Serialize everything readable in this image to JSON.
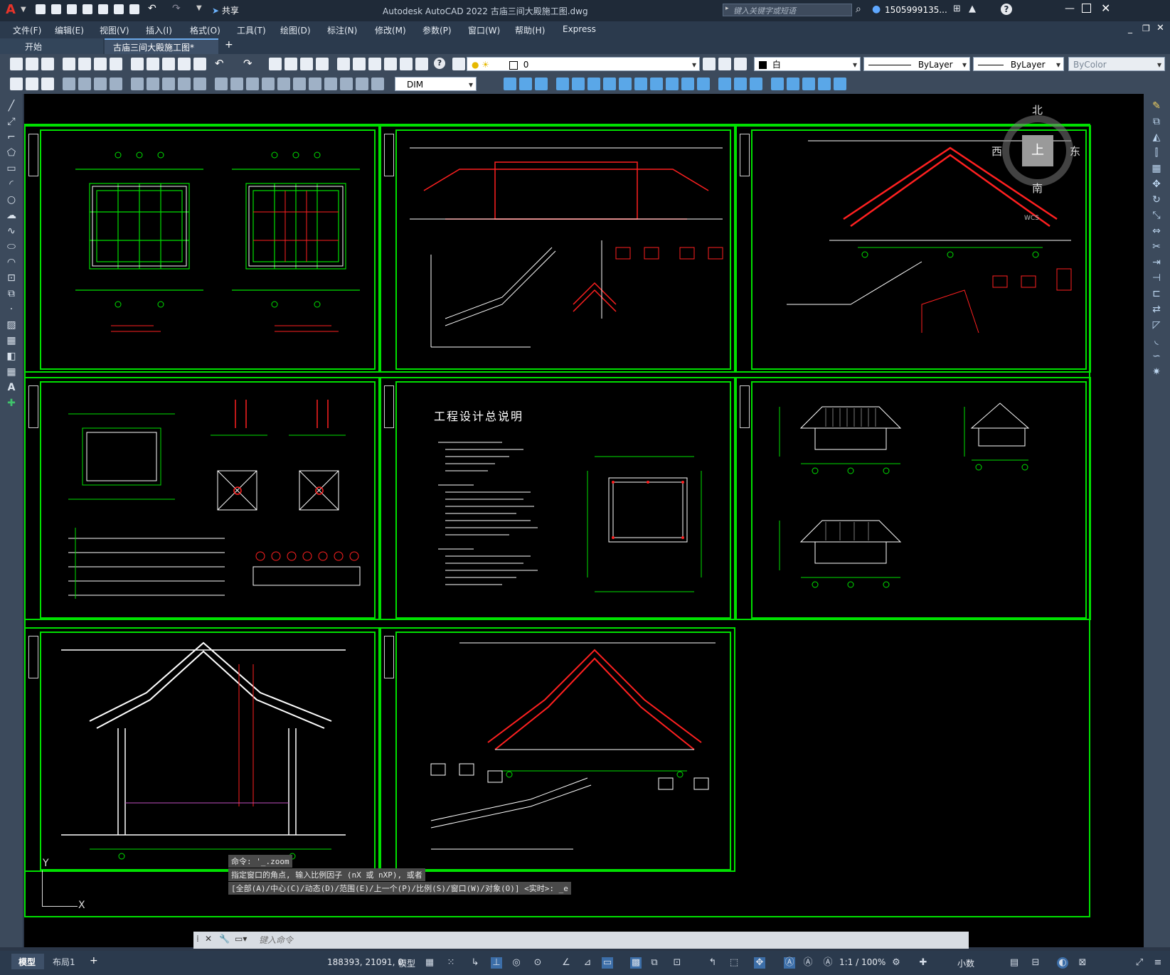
{
  "app": {
    "title": "Autodesk AutoCAD 2022    古庙三间大殿施工图.dwg",
    "share_label": "共享",
    "search_placeholder": "键入关键字或短语",
    "user": "1505999135...",
    "logo_letter": "A"
  },
  "menu": [
    "文件(F)",
    "编辑(E)",
    "视图(V)",
    "插入(I)",
    "格式(O)",
    "工具(T)",
    "绘图(D)",
    "标注(N)",
    "修改(M)",
    "参数(P)",
    "窗口(W)",
    "帮助(H)",
    "Express"
  ],
  "tabs": {
    "start": "开始",
    "active": "古庙三间大殿施工图*",
    "add": "+"
  },
  "toolbar": {
    "layer_value": "0",
    "color_value": "白",
    "linetype_value": "ByLayer",
    "lineweight_value": "ByLayer",
    "plotstyle_value": "ByColor",
    "dimstyle_value": "DIM"
  },
  "viewcube": {
    "north": "北",
    "south": "南",
    "east": "东",
    "west": "西",
    "top": "上",
    "wcs": "WCS"
  },
  "drawing": {
    "notes_title": "工程设计总说明",
    "ucs_y": "Y",
    "ucs_x": "X"
  },
  "command": {
    "history": [
      "命令: '_.zoom",
      "指定窗口的角点, 输入比例因子 (nX 或 nXP), 或者",
      "[全部(A)/中心(C)/动态(D)/范围(E)/上一个(P)/比例(S)/窗口(W)/对象(O)] <实时>: _e"
    ],
    "placeholder": "键入命令"
  },
  "status": {
    "model_tab": "模型",
    "layout_tab": "布局1",
    "add": "+",
    "coords": "188393, 21091, 0",
    "space": "模型",
    "scale": "1:1 / 100%",
    "units": "小数"
  },
  "colors": {
    "frame": "#00e000",
    "red": "#ff2020",
    "white": "#ffffff",
    "canvas": "#000000"
  }
}
